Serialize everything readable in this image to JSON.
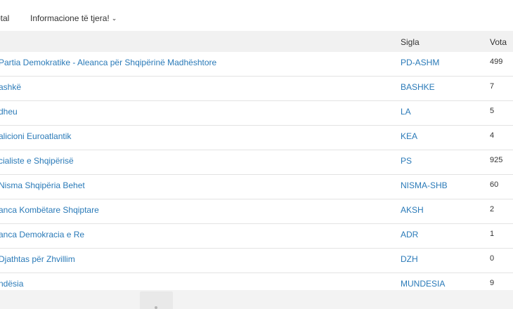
{
  "nav": {
    "total_label": "otal",
    "more_label": "Informacione të tjera!",
    "more_icon": "chevron-down-icon"
  },
  "table": {
    "headers": {
      "name": "",
      "sigla": "Sigla",
      "vota": "Vota"
    },
    "rows": [
      {
        "name": " Partia Demokratike - Aleanca për Shqipërinë Madhështore",
        "sigla": "PD-ASHM",
        "vota": "499"
      },
      {
        "name": "ashkë",
        "sigla": "BASHKE",
        "vota": "7"
      },
      {
        "name": "dheu",
        "sigla": "LA",
        "vota": "5"
      },
      {
        "name": "alicioni Euroatlantik",
        "sigla": "KEA",
        "vota": "4"
      },
      {
        "name": "cialiste e Shqipërisë",
        "sigla": "PS",
        "vota": "925"
      },
      {
        "name": " Nisma Shqipëria Behet",
        "sigla": "NISMA-SHB",
        "vota": "60"
      },
      {
        "name": "anca Kombëtare Shqiptare",
        "sigla": "AKSH",
        "vota": "2"
      },
      {
        "name": "anca Demokracia e Re",
        "sigla": "ADR",
        "vota": "1"
      },
      {
        "name": " Djathtas për Zhvillim",
        "sigla": "DZH",
        "vota": "0"
      },
      {
        "name": "ndësia",
        "sigla": "MUNDESIA",
        "vota": "9"
      }
    ]
  },
  "colors": {
    "link": "#2a7ab8",
    "header_bg": "#f1f1f1",
    "row_border": "#e3e3e3"
  }
}
